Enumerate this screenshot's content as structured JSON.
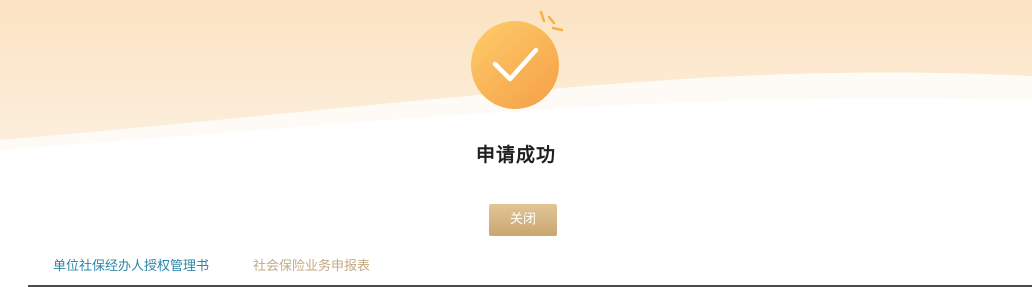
{
  "dialog": {
    "title": "申请成功",
    "close_label": "关闭",
    "status_icon": "check-circle-icon"
  },
  "tabs": [
    {
      "label": "单位社保经办人授权管理书",
      "active": true
    },
    {
      "label": "社会保险业务申报表",
      "active": false
    }
  ],
  "colors": {
    "accent_gold": "#c9a571",
    "icon_orange": "#f6ad4c",
    "active_tab": "#2b86a8",
    "inactive_tab": "#c3aa85"
  }
}
